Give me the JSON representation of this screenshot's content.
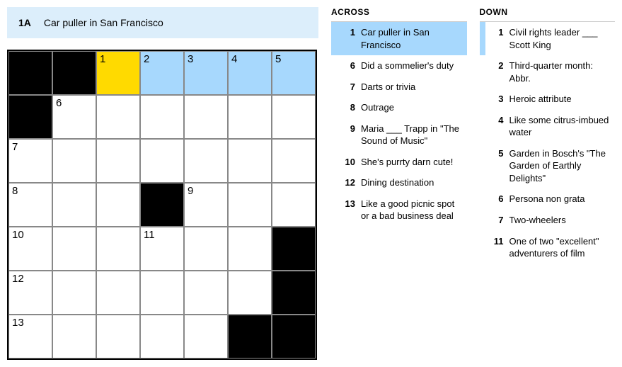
{
  "current_clue": {
    "id": "1A",
    "text": "Car puller in San Francisco"
  },
  "grid": {
    "cols": 7,
    "rows": 7,
    "cells": [
      {
        "r": 0,
        "c": 0,
        "block": true
      },
      {
        "r": 0,
        "c": 1,
        "block": true
      },
      {
        "r": 0,
        "c": 2,
        "num": "1",
        "focus": true
      },
      {
        "r": 0,
        "c": 3,
        "num": "2",
        "hl": true
      },
      {
        "r": 0,
        "c": 4,
        "num": "3",
        "hl": true
      },
      {
        "r": 0,
        "c": 5,
        "num": "4",
        "hl": true
      },
      {
        "r": 0,
        "c": 6,
        "num": "5",
        "hl": true
      },
      {
        "r": 1,
        "c": 0,
        "block": true
      },
      {
        "r": 1,
        "c": 1,
        "num": "6"
      },
      {
        "r": 1,
        "c": 2
      },
      {
        "r": 1,
        "c": 3
      },
      {
        "r": 1,
        "c": 4
      },
      {
        "r": 1,
        "c": 5
      },
      {
        "r": 1,
        "c": 6
      },
      {
        "r": 2,
        "c": 0,
        "num": "7"
      },
      {
        "r": 2,
        "c": 1
      },
      {
        "r": 2,
        "c": 2
      },
      {
        "r": 2,
        "c": 3
      },
      {
        "r": 2,
        "c": 4
      },
      {
        "r": 2,
        "c": 5
      },
      {
        "r": 2,
        "c": 6
      },
      {
        "r": 3,
        "c": 0,
        "num": "8"
      },
      {
        "r": 3,
        "c": 1
      },
      {
        "r": 3,
        "c": 2
      },
      {
        "r": 3,
        "c": 3,
        "block": true
      },
      {
        "r": 3,
        "c": 4,
        "num": "9"
      },
      {
        "r": 3,
        "c": 5
      },
      {
        "r": 3,
        "c": 6
      },
      {
        "r": 4,
        "c": 0,
        "num": "10"
      },
      {
        "r": 4,
        "c": 1
      },
      {
        "r": 4,
        "c": 2
      },
      {
        "r": 4,
        "c": 3,
        "num": "11"
      },
      {
        "r": 4,
        "c": 4
      },
      {
        "r": 4,
        "c": 5
      },
      {
        "r": 4,
        "c": 6,
        "block": true
      },
      {
        "r": 5,
        "c": 0,
        "num": "12"
      },
      {
        "r": 5,
        "c": 1
      },
      {
        "r": 5,
        "c": 2
      },
      {
        "r": 5,
        "c": 3
      },
      {
        "r": 5,
        "c": 4
      },
      {
        "r": 5,
        "c": 5
      },
      {
        "r": 5,
        "c": 6,
        "block": true
      },
      {
        "r": 6,
        "c": 0,
        "num": "13"
      },
      {
        "r": 6,
        "c": 1
      },
      {
        "r": 6,
        "c": 2
      },
      {
        "r": 6,
        "c": 3
      },
      {
        "r": 6,
        "c": 4
      },
      {
        "r": 6,
        "c": 5,
        "block": true
      },
      {
        "r": 6,
        "c": 6,
        "block": true
      }
    ]
  },
  "across": {
    "heading": "ACROSS",
    "clues": [
      {
        "num": "1",
        "text": "Car puller in San Francisco",
        "active": true
      },
      {
        "num": "6",
        "text": "Did a sommelier's duty"
      },
      {
        "num": "7",
        "text": "Darts or trivia"
      },
      {
        "num": "8",
        "text": "Outrage"
      },
      {
        "num": "9",
        "text": "Maria ___ Trapp in \"The Sound of Music\""
      },
      {
        "num": "10",
        "text": "She's purrty darn cute!"
      },
      {
        "num": "12",
        "text": "Dining destination"
      },
      {
        "num": "13",
        "text": "Like a good picnic spot or a bad business deal"
      }
    ]
  },
  "down": {
    "heading": "DOWN",
    "clues": [
      {
        "num": "1",
        "text": "Civil rights leader ___ Scott King",
        "related": true
      },
      {
        "num": "2",
        "text": "Third-quarter month: Abbr."
      },
      {
        "num": "3",
        "text": "Heroic attribute"
      },
      {
        "num": "4",
        "text": "Like some citrus-imbued water"
      },
      {
        "num": "5",
        "text": "Garden in Bosch's \"The Garden of Earthly Delights\""
      },
      {
        "num": "6",
        "text": "Persona non grata"
      },
      {
        "num": "7",
        "text": "Two-wheelers"
      },
      {
        "num": "11",
        "text": "One of two \"excellent\" adventurers of film"
      }
    ]
  }
}
